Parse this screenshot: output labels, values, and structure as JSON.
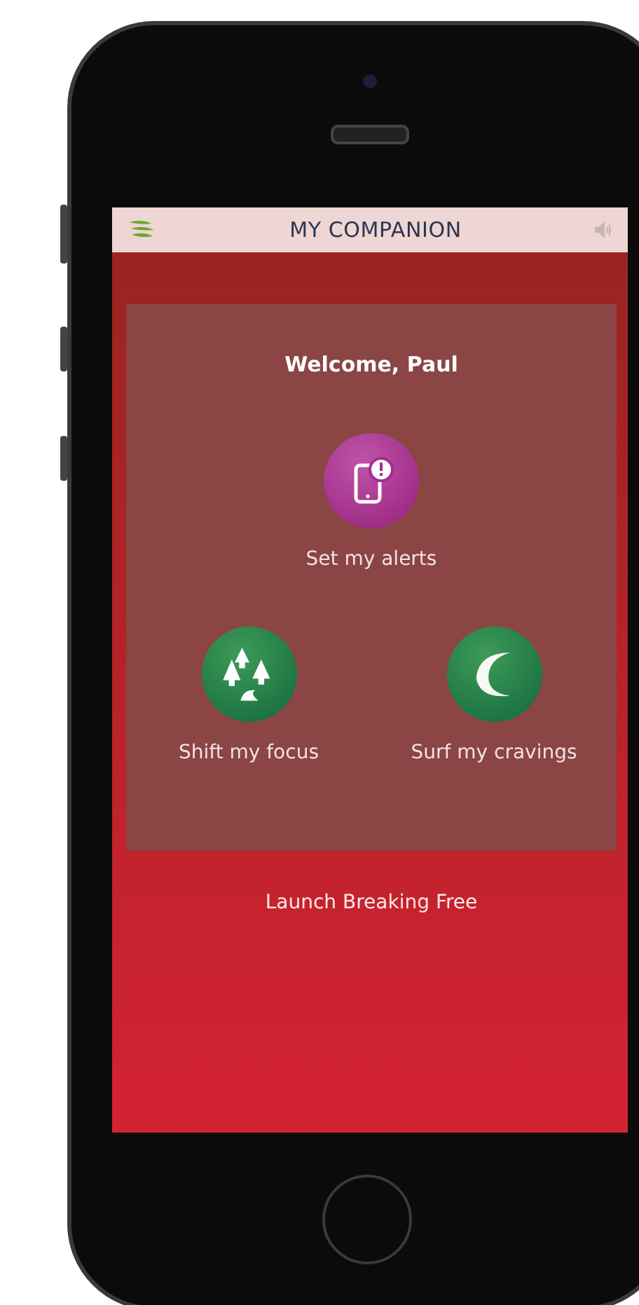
{
  "header": {
    "title": "MY COMPANION"
  },
  "welcome": "Welcome, Paul",
  "actions": [
    {
      "kind": "alert",
      "label": "Set my alerts"
    },
    {
      "kind": "forest",
      "label": "Shift my focus"
    },
    {
      "kind": "wave",
      "label": "Surf my cravings"
    }
  ],
  "launch_link": "Launch Breaking Free"
}
